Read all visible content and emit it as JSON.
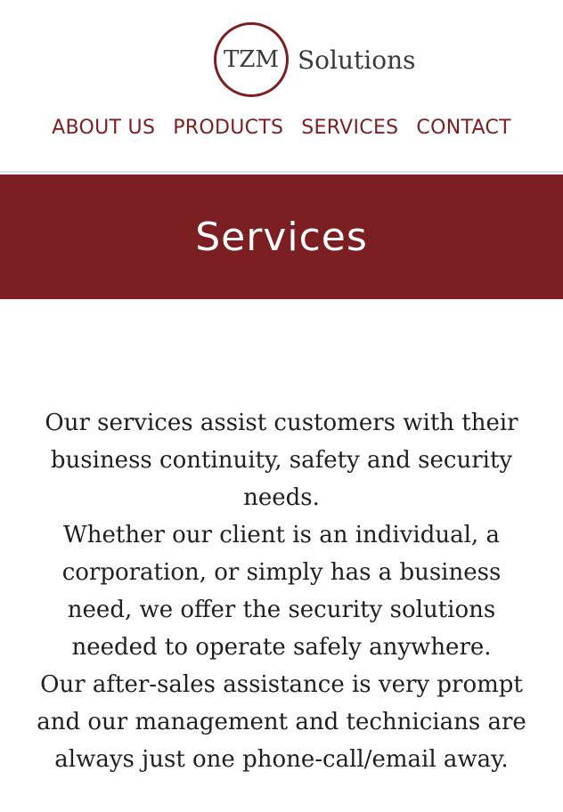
{
  "logo": {
    "mark": "TZM",
    "word": "Solutions"
  },
  "nav": {
    "items": [
      {
        "label": "ABOUT US"
      },
      {
        "label": "PRODUCTS"
      },
      {
        "label": "SERVICES"
      },
      {
        "label": "CONTACT"
      }
    ]
  },
  "banner": {
    "title": "Services"
  },
  "content": {
    "paragraphs": [
      "Our services assist customers with their business continuity, safety and security needs.",
      "Whether our client is an individual, a corporation, or simply has a business need, we offer the security solutions needed to operate safely anywhere.",
      "Our after-sales assistance is very prompt and our management and technicians are always just one phone-call/email away."
    ]
  },
  "colors": {
    "brand": "#7b1f22",
    "text": "#1f1f1f",
    "logo_text": "#3a3a3a"
  }
}
